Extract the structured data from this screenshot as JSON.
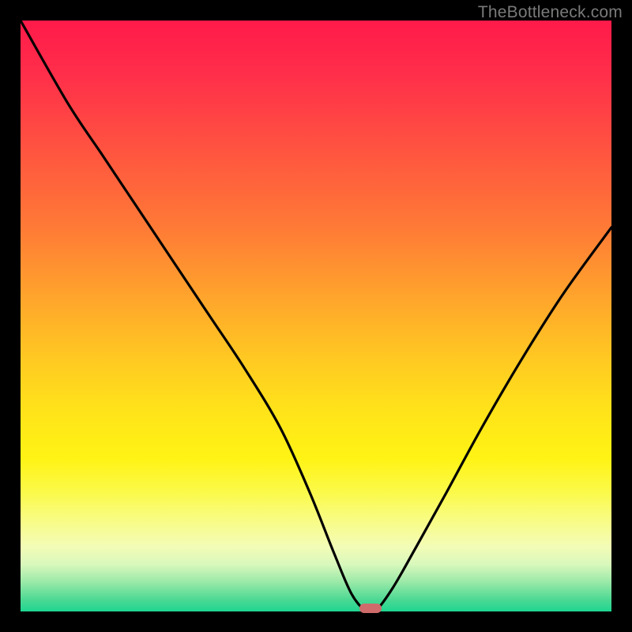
{
  "watermark": "TheBottleneck.com",
  "colors": {
    "frame_bg": "#000000",
    "curve_stroke": "#000000",
    "marker_fill": "#cf6b6b"
  },
  "chart_data": {
    "type": "line",
    "title": "",
    "xlabel": "",
    "ylabel": "",
    "xlim": [
      0,
      100
    ],
    "ylim": [
      0,
      100
    ],
    "grid": false,
    "legend": false,
    "series": [
      {
        "name": "bottleneck-curve",
        "x": [
          0,
          8,
          14,
          20,
          26,
          32,
          38,
          44,
          49,
          53,
          56,
          58.5,
          60,
          63,
          67,
          72,
          78,
          85,
          92,
          100
        ],
        "y": [
          100,
          86,
          77,
          68,
          59,
          50,
          41,
          31,
          20,
          10,
          3,
          0,
          0,
          4,
          11,
          20,
          31,
          43,
          54,
          65
        ]
      }
    ],
    "annotations": [
      {
        "name": "min-marker",
        "x": 59.2,
        "y": 0.5,
        "shape": "pill"
      }
    ]
  }
}
